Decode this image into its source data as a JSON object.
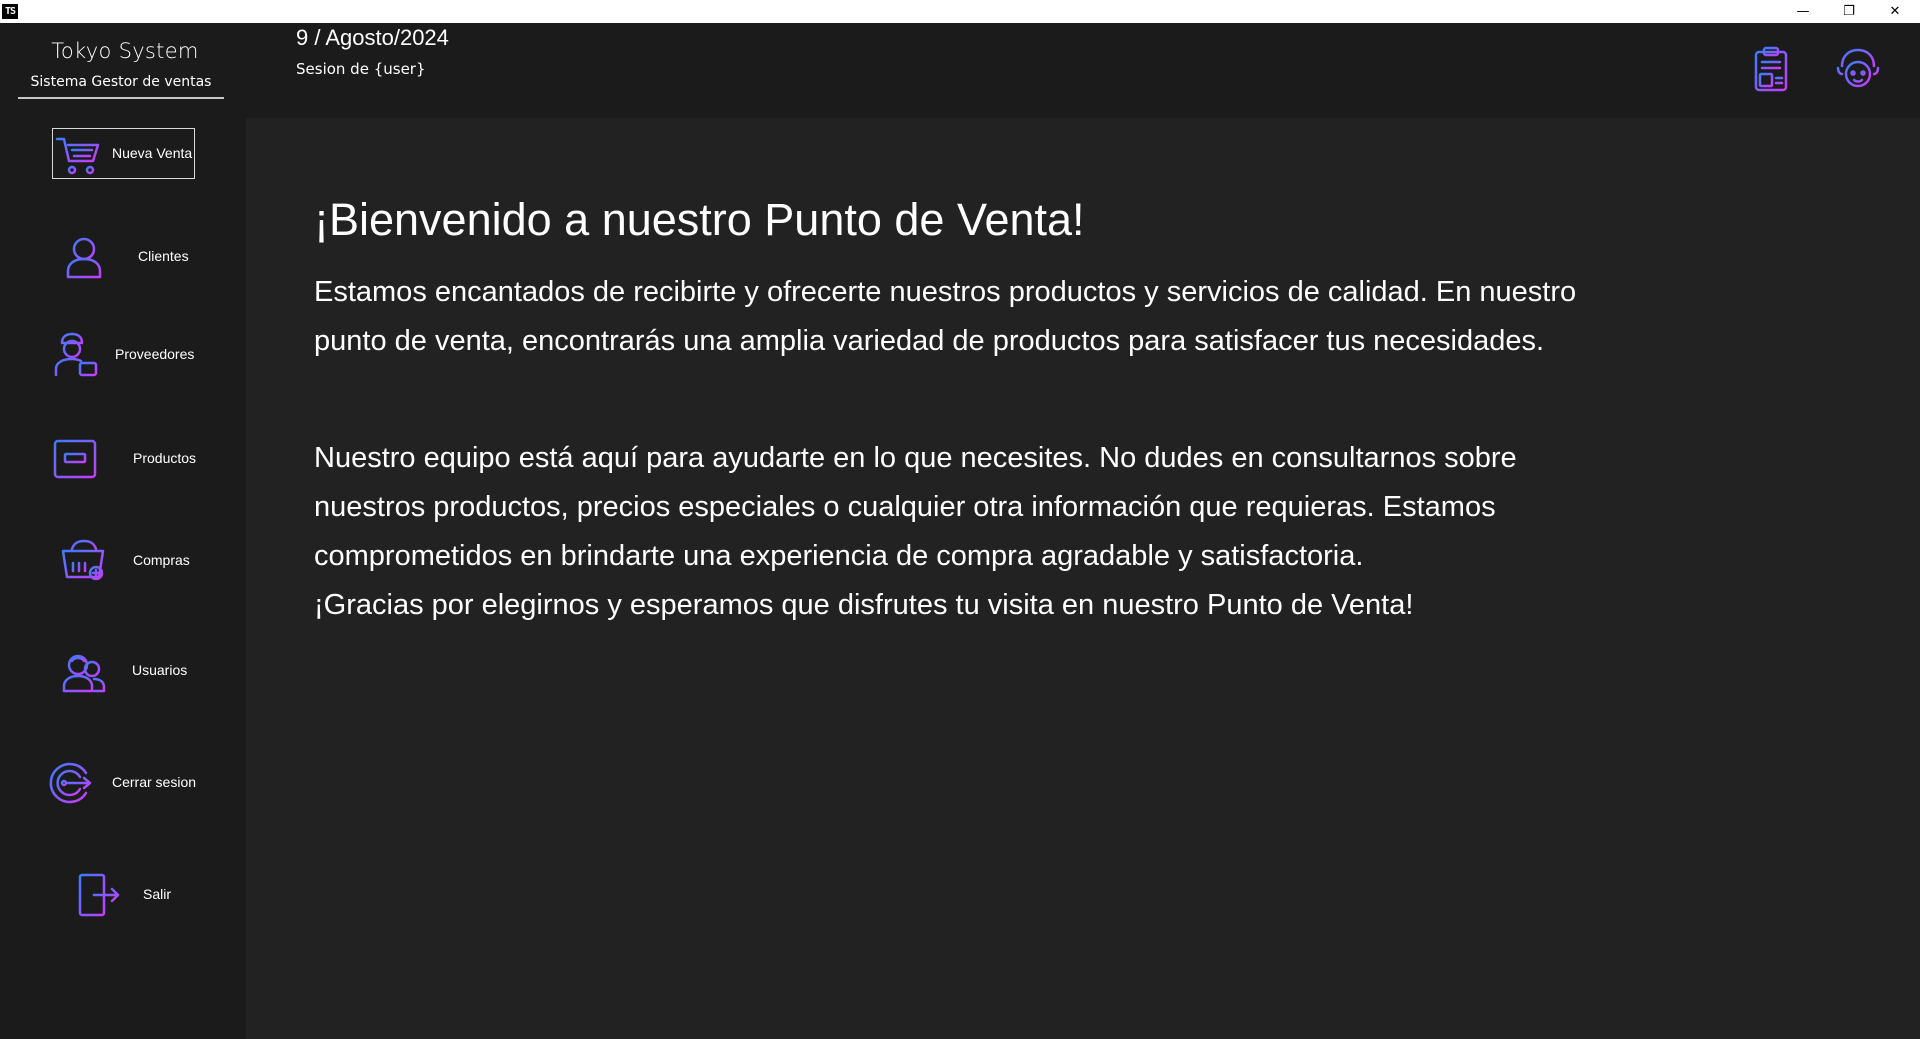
{
  "window": {
    "app_icon_text": "TS",
    "minimize_glyph": "—",
    "maximize_glyph": "❐",
    "close_glyph": "✕"
  },
  "brand": {
    "title": "Tokyo System",
    "subtitle": "Sistema Gestor de ventas"
  },
  "sidebar": {
    "items": [
      {
        "label": "Nueva Venta",
        "icon": "shopping-cart-icon",
        "selected": true
      },
      {
        "label": "Clientes",
        "icon": "customer-icon",
        "selected": false
      },
      {
        "label": "Proveedores",
        "icon": "supplier-icon",
        "selected": false
      },
      {
        "label": "Productos",
        "icon": "products-icon",
        "selected": false
      },
      {
        "label": "Compras",
        "icon": "shopping-basket-icon",
        "selected": false
      },
      {
        "label": "Usuarios",
        "icon": "users-icon",
        "selected": false
      },
      {
        "label": "Cerrar sesion",
        "icon": "logout-icon",
        "selected": false
      },
      {
        "label": "Salir",
        "icon": "exit-door-icon",
        "selected": false
      }
    ]
  },
  "header": {
    "date": "9 / Agosto/2024",
    "session": "Sesion de {user}",
    "actions": [
      {
        "icon": "clipboard-report-icon"
      },
      {
        "icon": "user-profile-icon"
      }
    ]
  },
  "main": {
    "title": "¡Bienvenido a nuestro Punto de Venta!",
    "paragraph1": "Estamos encantados de recibirte y ofrecerte nuestros productos y servicios de calidad. En nuestro punto de venta, encontrarás una amplia variedad de productos para satisfacer tus necesidades.",
    "paragraph2": "Nuestro equipo está aquí para ayudarte en lo que necesites. No dudes en consultarnos sobre nuestros productos, precios especiales o cualquier otra información que requieras. Estamos comprometidos en brindarte una experiencia de compra agradable y satisfactoria.",
    "paragraph3": "¡Gracias por elegirnos y esperamos que disfrutes tu visita en nuestro Punto de Venta!"
  },
  "colors": {
    "background": "#1b1b1b",
    "content_background": "#222222",
    "icon_gradient_start": "#3b7cff",
    "icon_gradient_end": "#c83cff",
    "text": "#ffffff"
  }
}
